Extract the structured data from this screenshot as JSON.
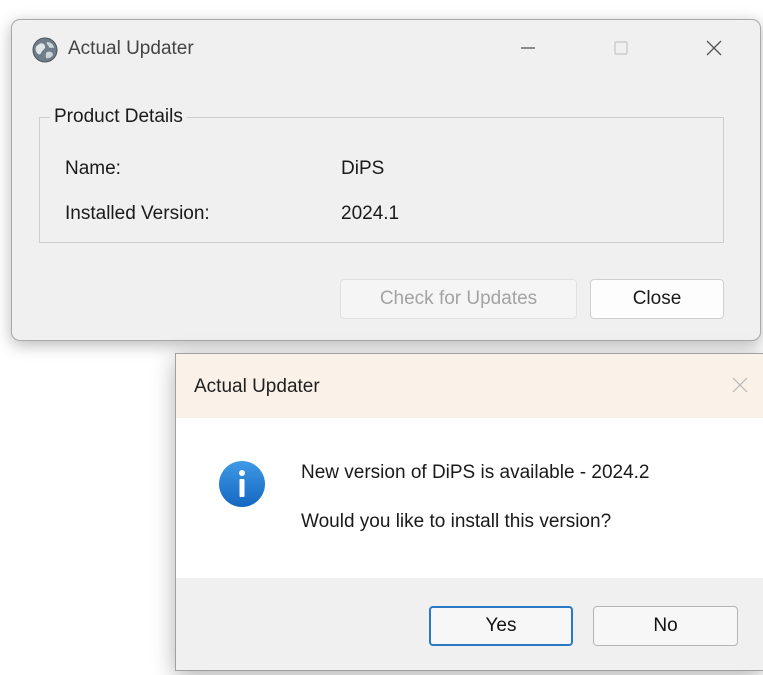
{
  "main_window": {
    "title": "Actual Updater",
    "icon": "globe-icon",
    "controls": {
      "minimize_icon": "minimize-icon",
      "maximize_icon": "maximize-icon",
      "close_icon": "close-icon"
    },
    "group": {
      "legend": "Product Details",
      "name_label": "Name:",
      "name_value": "DiPS",
      "version_label": "Installed Version:",
      "version_value": "2024.1"
    },
    "buttons": {
      "check_label": "Check for Updates",
      "check_enabled": false,
      "close_label": "Close"
    }
  },
  "dialog": {
    "title": "Actual Updater",
    "icon": "info-icon",
    "message_line_1": "New version of DiPS is available - 2024.2",
    "message_line_2": "Would you like to install this version?",
    "yes_label": "Yes",
    "no_label": "No",
    "default_button": "yes"
  },
  "colors": {
    "dialog_title_bg": "#faf1e9",
    "info_blue": "#1a73c9",
    "focus_border": "#2b78c5",
    "disabled_text": "#a3a3a3"
  }
}
